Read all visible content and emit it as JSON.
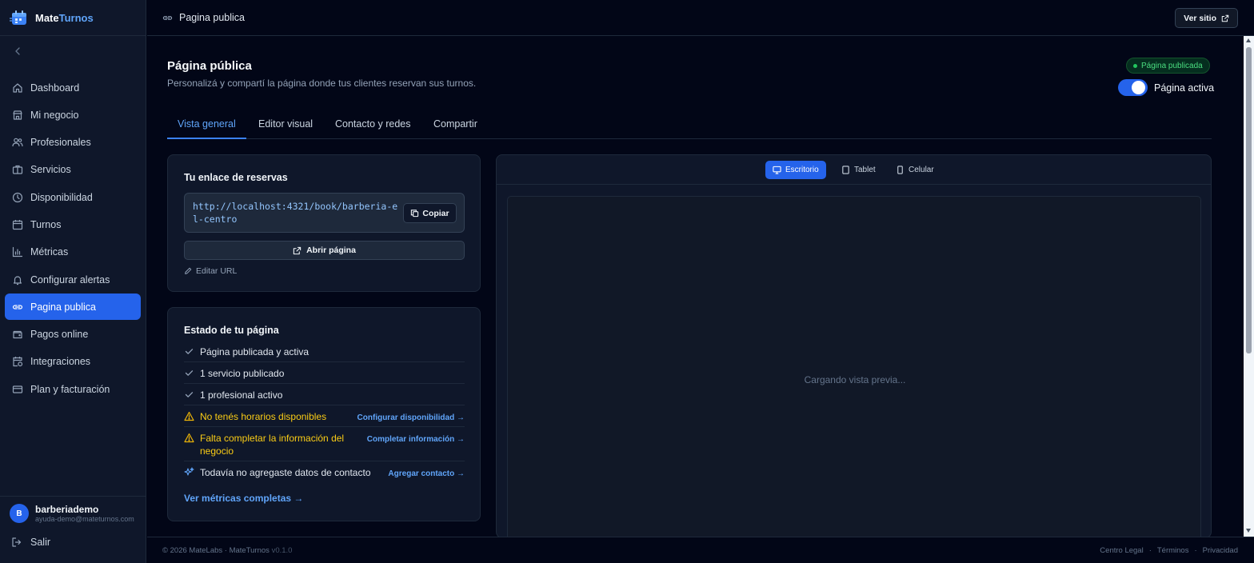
{
  "app": {
    "name_a": "Mate",
    "name_b": "Turnos"
  },
  "sidebar": {
    "items": [
      {
        "label": "Dashboard",
        "icon": "home-icon"
      },
      {
        "label": "Mi negocio",
        "icon": "store-icon"
      },
      {
        "label": "Profesionales",
        "icon": "users-icon"
      },
      {
        "label": "Servicios",
        "icon": "briefcase-icon"
      },
      {
        "label": "Disponibilidad",
        "icon": "clock-icon"
      },
      {
        "label": "Turnos",
        "icon": "calendar-icon"
      },
      {
        "label": "Métricas",
        "icon": "bar-chart-icon"
      },
      {
        "label": "Configurar alertas",
        "icon": "bell-icon"
      },
      {
        "label": "Pagina publica",
        "icon": "link-icon",
        "active": true
      },
      {
        "label": "Pagos online",
        "icon": "wallet-icon"
      },
      {
        "label": "Integraciones",
        "icon": "calendar-sync-icon"
      },
      {
        "label": "Plan y facturación",
        "icon": "credit-card-icon"
      }
    ],
    "user": {
      "initial": "B",
      "name": "barberiademo",
      "email": "ayuda-demo@mateturnos.com"
    },
    "logout_label": "Salir"
  },
  "topbar": {
    "breadcrumb": "Pagina publica",
    "ver_sitio_label": "Ver sitio"
  },
  "page": {
    "title": "Página pública",
    "subtitle": "Personalizá y compartí la página donde tus clientes reservan sus turnos.",
    "status_badge": "Página publicada",
    "toggle_label": "Página activa",
    "toggle_on": true
  },
  "tabs": [
    {
      "label": "Vista general",
      "active": true
    },
    {
      "label": "Editor visual"
    },
    {
      "label": "Contacto y redes"
    },
    {
      "label": "Compartir"
    }
  ],
  "link_card": {
    "title": "Tu enlace de reservas",
    "url": "http://localhost:4321/book/barberia-el-centro",
    "copy_label": "Copiar",
    "open_label": "Abrir página",
    "edit_label": "Editar URL"
  },
  "status_card": {
    "title": "Estado de tu página",
    "rows": [
      {
        "text": "Página publicada y activa",
        "kind": "ok"
      },
      {
        "text": "1 servicio publicado",
        "kind": "ok"
      },
      {
        "text": "1 profesional activo",
        "kind": "ok"
      },
      {
        "text": "No tenés horarios disponibles",
        "kind": "warn",
        "link": "Configurar disponibilidad →"
      },
      {
        "text": "Falta completar la información del negocio",
        "kind": "warn",
        "link": "Completar información →"
      },
      {
        "text": "Todavía no agregaste datos de contacto",
        "kind": "info",
        "link": "Agregar contacto →"
      }
    ],
    "metrics_link": "Ver métricas completas →"
  },
  "preview": {
    "devices": [
      {
        "label": "Escritorio",
        "icon": "monitor-icon",
        "active": true
      },
      {
        "label": "Tablet",
        "icon": "tablet-icon"
      },
      {
        "label": "Celular",
        "icon": "smartphone-icon"
      }
    ],
    "loading_text": "Cargando vista previa..."
  },
  "footer": {
    "copyright": "© 2026 MateLabs · MateTurnos ",
    "version": "v0.1.0",
    "links": [
      "Centro Legal",
      "·",
      "Términos",
      "·",
      "Privacidad"
    ]
  },
  "colors": {
    "accent": "#2563eb",
    "success": "#22c55e",
    "warning": "#eab308",
    "link": "#60a5fa"
  }
}
